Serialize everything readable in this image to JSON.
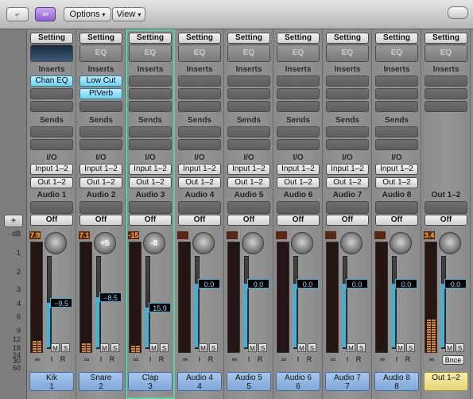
{
  "toolbar": {
    "options_label": "Options",
    "view_label": "View"
  },
  "left_panel": {
    "add_label": "+",
    "scale_labels": [
      "- dB",
      "1",
      "2",
      "3",
      "4",
      "6",
      "9",
      "12",
      "18",
      "24",
      "30",
      "60"
    ]
  },
  "labels": {
    "setting": "Setting",
    "eq": "EQ",
    "inserts": "Inserts",
    "sends": "Sends",
    "io": "I/O",
    "off": "Off",
    "mute": "M",
    "solo": "S",
    "record": "R",
    "input_mon": "I"
  },
  "strips": [
    {
      "channel": "Audio 1",
      "input": "Input 1–2",
      "output": "Out 1–2",
      "inserts": [
        "Chan EQ"
      ],
      "eq_thumb": true,
      "peak": "7.9",
      "pan": "",
      "fader": "−9.5",
      "name": "Kik",
      "number": "1",
      "selected": false
    },
    {
      "channel": "Audio 2",
      "input": "Input 1–2",
      "output": "Out 1–2",
      "inserts": [
        "Low Cut",
        "PtVerb"
      ],
      "eq_thumb": false,
      "peak": "7.1",
      "pan": "+5",
      "fader": "−8.5",
      "name": "Snare",
      "number": "2",
      "selected": false
    },
    {
      "channel": "Audio 3",
      "input": "Input 1–2",
      "output": "Out 1–2",
      "inserts": [],
      "eq_thumb": false,
      "peak": "-15",
      "pan": "-8",
      "fader": "15.9",
      "name": "Clap",
      "number": "3",
      "selected": true
    },
    {
      "channel": "Audio 4",
      "input": "Input 1–2",
      "output": "Out 1–2",
      "inserts": [],
      "eq_thumb": false,
      "peak": "",
      "pan": "",
      "fader": "0.0",
      "name": "Audio 4",
      "number": "4",
      "selected": false
    },
    {
      "channel": "Audio 5",
      "input": "Input 1–2",
      "output": "Out 1–2",
      "inserts": [],
      "eq_thumb": false,
      "peak": "",
      "pan": "",
      "fader": "0.0",
      "name": "Audio 5",
      "number": "5",
      "selected": false
    },
    {
      "channel": "Audio 6",
      "input": "Input 1–2",
      "output": "Out 1–2",
      "inserts": [],
      "eq_thumb": false,
      "peak": "",
      "pan": "",
      "fader": "0.0",
      "name": "Audio 6",
      "number": "6",
      "selected": false
    },
    {
      "channel": "Audio 7",
      "input": "Input 1–2",
      "output": "Out 1–2",
      "inserts": [],
      "eq_thumb": false,
      "peak": "",
      "pan": "",
      "fader": "0.0",
      "name": "Audio 7",
      "number": "7",
      "selected": false
    },
    {
      "channel": "Audio 8",
      "input": "Input 1–2",
      "output": "Out 1–2",
      "inserts": [],
      "eq_thumb": false,
      "peak": "",
      "pan": "",
      "fader": "0.0",
      "name": "Audio 8",
      "number": "8",
      "selected": false
    },
    {
      "channel": "Out 1–2",
      "input": "",
      "output": "",
      "inserts": [],
      "eq_thumb": false,
      "peak": "3.4",
      "pan": "",
      "fader": "0.0",
      "name": "Out 1–2",
      "number": "",
      "bounce": "Bnce",
      "selected": false,
      "output_strip": true
    }
  ]
}
